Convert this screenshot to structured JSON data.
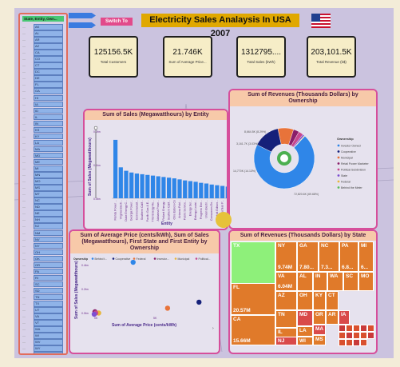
{
  "app_title": "Electricity Sales Analaysis In USA 2007",
  "switch_button": "Switch To",
  "slicer": {
    "header": "State, Entity, Own...",
    "items": [
      "AK",
      "AL",
      "AR",
      "AZ",
      "CA",
      "CO",
      "CT",
      "DC",
      "DE",
      "FL",
      "GA",
      "HI",
      "IA",
      "ID",
      "IL",
      "IN",
      "KS",
      "KY",
      "LA",
      "MA",
      "MD",
      "ME",
      "MI",
      "MN",
      "MO",
      "MS",
      "MT",
      "NC",
      "ND",
      "NE",
      "NH",
      "NJ",
      "NM",
      "NV",
      "NY",
      "OH",
      "OK",
      "OR",
      "PA",
      "RI",
      "SC",
      "SD",
      "TN",
      "TX",
      "UT",
      "VA",
      "VT",
      "WA",
      "WI",
      "WV",
      "WY",
      "AK",
      "AL"
    ]
  },
  "kpis": [
    {
      "value": "125156.5K",
      "label": "Total Customers"
    },
    {
      "value": "21.746K",
      "label": "Sum of Average Price..."
    },
    {
      "value": "1312795....",
      "label": "Total Sales (kWh)"
    },
    {
      "value": "203,101.5K",
      "label": "Total Revenue (k$)"
    }
  ],
  "bar_chart": {
    "title": "Sum of Sales (Megawatthours) by Entity",
    "ylabel": "Sum of Sales (Megawatthours)",
    "xlabel": "Entity",
    "yticks": [
      "0.2bn",
      "0.1bn",
      "0.0bn"
    ],
    "entity_labels": [
      "Florida Power ...",
      "Virginia Electr...",
      "Duke Energy C...",
      "Georgia Power...",
      "Commonwealt...",
      "Southern Calif...",
      "Pacific Gas & E...",
      "TXU Energy Re...",
      "Alabama Powe...",
      "Reliant Energy...",
      "Southern Calif...",
      "Ohio Edison Co",
      "Arizona Publ...",
      "Public Service...",
      "Energy Ser...",
      "Entergy Louisi...",
      "Progress Ene...",
      "Union Electri...",
      "Consumers En...",
      "Detroit Edison...",
      "Appalachian P...",
      "Duquesne Ligh..."
    ]
  },
  "chart_data": [
    {
      "type": "bar",
      "title": "Sum of Sales (Megawatthours) by Entity",
      "xlabel": "Entity",
      "ylabel": "Sum of Sales (Megawatthours)",
      "ylim": [
        0,
        0.2
      ],
      "categories": [
        "Florida Power ...",
        "Virginia Electr...",
        "Duke Energy C...",
        "Georgia Power...",
        "Commonwealt...",
        "Southern Calif...",
        "Pacific Gas & E...",
        "TXU Energy Re...",
        "Alabama Powe...",
        "Reliant Energy...",
        "Southern Calif...",
        "Ohio Edison Co",
        "Arizona Publ...",
        "Public Service...",
        "Energy Ser...",
        "Entergy Louisi...",
        "Progress Ene...",
        "Union Electri...",
        "Consumers En...",
        "Detroit Edison...",
        "Appalachian P...",
        "Duquesne Ligh..."
      ],
      "values": [
        0.17,
        0.09,
        0.08,
        0.075,
        0.072,
        0.07,
        0.068,
        0.066,
        0.064,
        0.062,
        0.06,
        0.058,
        0.055,
        0.052,
        0.05,
        0.048,
        0.045,
        0.043,
        0.04,
        0.038,
        0.036,
        0.034
      ]
    },
    {
      "type": "pie",
      "title": "Sum of Revenues (Thousands Dollars) by Ownership",
      "legend_title": "Ownership",
      "categories": [
        "Investor Owned",
        "Cooperative",
        "Municipal",
        "Retail Power Marketer",
        "Political Subdivision",
        "State",
        "Federal",
        "Behind the Meter"
      ],
      "values": [
        72.82,
        14.77,
        8.66,
        3.16,
        2.62,
        0.93,
        0.35,
        0.1
      ],
      "data_labels": [
        "72,820.6K (69.68%)",
        "14,770K (14.13%)",
        "8,664.5K (8.29%)",
        "3,161.7K (3.03%)"
      ],
      "colors": [
        "#2f86e8",
        "#15207a",
        "#e8733a",
        "#8a1e6a",
        "#c7478e",
        "#7c4fd1",
        "#e8b63a",
        "#5cbf5c"
      ]
    },
    {
      "type": "scatter",
      "title": "Sum of Average Price (cents/kWh), Sum of Sales (Megawatthours), First State and First Entity by Ownership",
      "xlabel": "Sum of Average Price (cents/kWh)",
      "ylabel": "Sum of Sales (Megawatthours)",
      "legend_title": "Ownership",
      "legend": [
        "Behind t...",
        "Cooperative",
        "Federal",
        "Investor...",
        "Municipal",
        "Political..."
      ],
      "yticks": [
        "0.4bn",
        "0.2bn",
        "0.0bn"
      ],
      "xticks": [
        "0K",
        "5K"
      ],
      "series": [
        {
          "name": "Investor...",
          "x": [
            2.6
          ],
          "y": [
            0.43
          ],
          "color": "#2f86e8"
        },
        {
          "name": "Cooperative",
          "x": [
            7.0
          ],
          "y": [
            0.1
          ],
          "color": "#15207a"
        },
        {
          "name": "Municipal",
          "x": [
            4.9
          ],
          "y": [
            0.05
          ],
          "color": "#e8733a"
        },
        {
          "name": "Political...",
          "x": [
            0.05
          ],
          "y": [
            0.02
          ],
          "color": "#8a1e6a"
        },
        {
          "name": "Behind t...",
          "x": [
            0.3
          ],
          "y": [
            0.01
          ],
          "color": "#e8b63a"
        },
        {
          "name": "Federal",
          "x": [
            0.1
          ],
          "y": [
            0.01
          ],
          "color": "#c7478e"
        },
        {
          "name": "State",
          "x": [
            0.0
          ],
          "y": [
            0.0
          ],
          "color": "#7c4fd1"
        }
      ]
    },
    {
      "type": "treemap",
      "title": "Sum of Revenues (Thousands Dollars) by State",
      "categories": [
        "TX",
        "FL",
        "CA",
        "NY",
        "GA",
        "NC",
        "PA",
        "MI",
        "VA",
        "AL",
        "IN",
        "WA",
        "SC",
        "MO",
        "AZ",
        "OH",
        "KY",
        "CT",
        "TN",
        "MD",
        "OR",
        "AR",
        "IA",
        "IL",
        "LA",
        "MA",
        "NJ",
        "MS",
        "WI"
      ],
      "values": [
        24.16,
        20.57,
        15.66,
        9.74,
        7.8,
        7.3,
        6.8,
        6.6,
        6.04,
        4.0,
        3.8,
        3.7,
        3.5,
        3.3,
        3.2,
        3.1,
        2.9,
        2.8,
        2.7,
        2.6,
        2.5,
        2.4,
        2.2,
        4.5,
        2.3,
        2.0,
        2.2,
        1.9,
        1.6
      ],
      "data_labels": [
        "24.16M",
        "20.57M",
        "15.66M",
        "9.74M",
        "7.80...",
        "7.3...",
        "6.8...",
        "6...",
        "6.04M"
      ]
    }
  ],
  "pie_chart": {
    "title": "Sum of Revenues (Thousands Dollars) by Ownership",
    "legend_title": "Ownership",
    "legend": [
      "Investor Owned",
      "Cooperative",
      "Municipal",
      "Retail Power Marketer",
      "Political Subdivision",
      "State",
      "Federal",
      "Behind the Meter"
    ],
    "labels": [
      "72,820.6K (69.68%)",
      "14,770K (14.13%)",
      "8,664.5K (8.29%)",
      "3,161.7K (3.03%)"
    ]
  },
  "scatter_chart": {
    "title": "Sum of Average Price (cents/kWh), Sum of Sales (Megawatthours), First State and First Entity by Ownership",
    "legend_title": "Ownership",
    "legend": [
      "Behind t...",
      "Cooperative",
      "Federal",
      "Investor...",
      "Municipal",
      "Political..."
    ],
    "ylabel": "Sum of Sales (Megawatthours)",
    "xlabel": "Sum of Average Price (cents/kWh)",
    "yticks": [
      "0.4bn",
      "0.2bn",
      "0.0bn"
    ],
    "xticks": [
      "0K",
      "5K"
    ]
  },
  "treemap": {
    "title": "Sum of Revenues (Thousands Dollars) by State"
  },
  "colors": {
    "panel_border": "#d64f9b",
    "panel_title_bg": "#f7c9a9",
    "bar": "#2f86e8",
    "title_bg": "#e0a800",
    "switch_bg": "#e24a8b"
  }
}
